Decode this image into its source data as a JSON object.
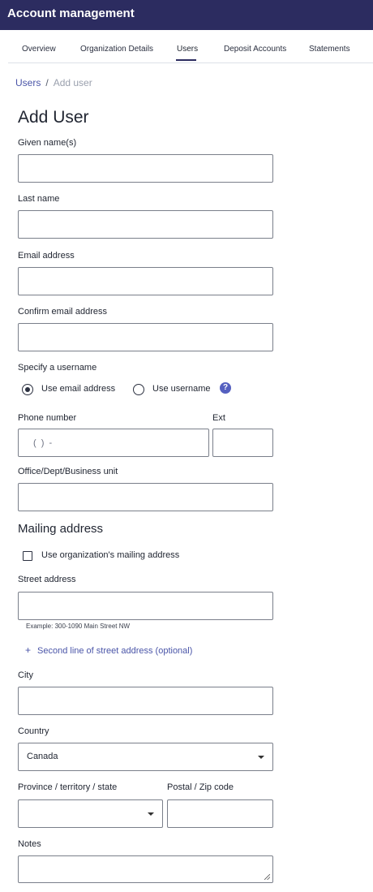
{
  "header": {
    "title": "Account management"
  },
  "tabs": [
    {
      "label": "Overview",
      "active": false
    },
    {
      "label": "Organization Details",
      "active": false
    },
    {
      "label": "Users",
      "active": true
    },
    {
      "label": "Deposit Accounts",
      "active": false
    },
    {
      "label": "Statements",
      "active": false
    }
  ],
  "breadcrumb": {
    "parent": "Users",
    "separator": "/",
    "current": "Add user"
  },
  "form": {
    "title": "Add User",
    "given_name_label": "Given name(s)",
    "last_name_label": "Last name",
    "email_label": "Email address",
    "confirm_email_label": "Confirm email address",
    "username_label": "Specify a username",
    "username_options": [
      {
        "label": "Use email address",
        "selected": true
      },
      {
        "label": "Use username",
        "selected": false
      }
    ],
    "help_icon": "?",
    "phone_label": "Phone number",
    "phone_placeholder": "(  )  -",
    "ext_label": "Ext",
    "office_label": "Office/Dept/Business unit"
  },
  "mailing": {
    "title": "Mailing address",
    "use_org_label": "Use organization's mailing address",
    "use_org_checked": false,
    "street_label": "Street address",
    "street_hint": "Example: 300-1090 Main Street NW",
    "add_line_icon": "+",
    "add_line_label": "Second line of street address (optional)",
    "city_label": "City",
    "country_label": "Country",
    "country_value": "Canada",
    "province_label": "Province / territory / state",
    "province_value": "",
    "postal_label": "Postal / Zip code",
    "notes_label": "Notes"
  },
  "colors": {
    "header_bg": "#2c2c60",
    "link": "#4a55a8",
    "help_icon": "#5560c0"
  }
}
